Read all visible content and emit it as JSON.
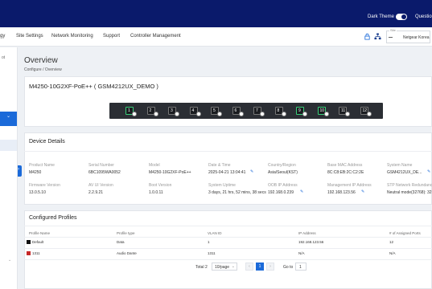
{
  "header": {
    "dark_theme_label": "Dark Theme",
    "questions_label": "Questio"
  },
  "nav": {
    "items": [
      "gy",
      "Site Settings",
      "Network Monitoring",
      "Support",
      "Controller Management"
    ],
    "site_label": "Site",
    "site_value": "Netgear Korea"
  },
  "sidebar": {
    "partial_text": "ot"
  },
  "page": {
    "title": "Overview",
    "breadcrumb": "Configure / Overview"
  },
  "device": {
    "model_title": "M4250-10G2XF-PoE++ ( GSM4212UX_DEMO )",
    "ports": [
      {
        "n": "1",
        "up": true
      },
      {
        "n": "2",
        "up": false
      },
      {
        "n": "3",
        "up": false
      },
      {
        "n": "4",
        "up": false
      },
      {
        "n": "5",
        "up": false
      },
      {
        "n": "6",
        "up": false
      },
      {
        "n": "7",
        "up": false
      },
      {
        "n": "8",
        "up": false
      },
      {
        "n": "9",
        "up": true
      },
      {
        "n": "10",
        "up": true
      },
      {
        "n": "11",
        "up": false
      },
      {
        "n": "12",
        "up": false
      }
    ]
  },
  "details": {
    "title": "Device Details",
    "row1": [
      {
        "label": "Product Name",
        "value": "M4250"
      },
      {
        "label": "Serial Number",
        "value": "6BC1095WA0052"
      },
      {
        "label": "Model",
        "value": "M4250-10G2XF-PoE++"
      },
      {
        "label": "Date & Time",
        "value": "2025-04-21 13:04:41"
      },
      {
        "label": "Country/Region",
        "value": "Asia/Seoul(KST)"
      },
      {
        "label": "Base MAC Address",
        "value": "8C:C8:EB:2C:C2:2E"
      },
      {
        "label": "System Name",
        "value": "GSM4212UX_DE..."
      }
    ],
    "row2": [
      {
        "label": "Firmware Version",
        "value": "13.0.5.10"
      },
      {
        "label": "AV UI Version",
        "value": "2.2.9.21"
      },
      {
        "label": "Boot Version",
        "value": "1.0.0.11"
      },
      {
        "label": "System Uptime",
        "value": "3 days, 21 hrs, 52 mins, 38 secs"
      },
      {
        "label": "OOB IP Address",
        "value": "192.168.0.239"
      },
      {
        "label": "Management IP Address",
        "value": "192.168.123.56"
      },
      {
        "label": "STP Network Redundancy",
        "value": "Neutral mode(32768): 32"
      }
    ]
  },
  "profiles": {
    "title": "Configured Profiles",
    "headers": [
      "Profile Name",
      "Profile type",
      "VLAN ID",
      "IP Address",
      "# of Assigned Ports"
    ],
    "rows": [
      {
        "name": "Default",
        "type": "Data",
        "vlan": "1",
        "ip": "192.168.123.56",
        "ports": "12",
        "color": "#111111"
      },
      {
        "name": "1311",
        "type": "Audio Dante",
        "vlan": "1311",
        "ip": "N/A",
        "ports": "N/A",
        "color": "#c62828"
      }
    ]
  },
  "pagination": {
    "total": "Total 2",
    "page_size": "10/page",
    "current": "1",
    "goto_label": "Go to",
    "goto_value": "1"
  }
}
